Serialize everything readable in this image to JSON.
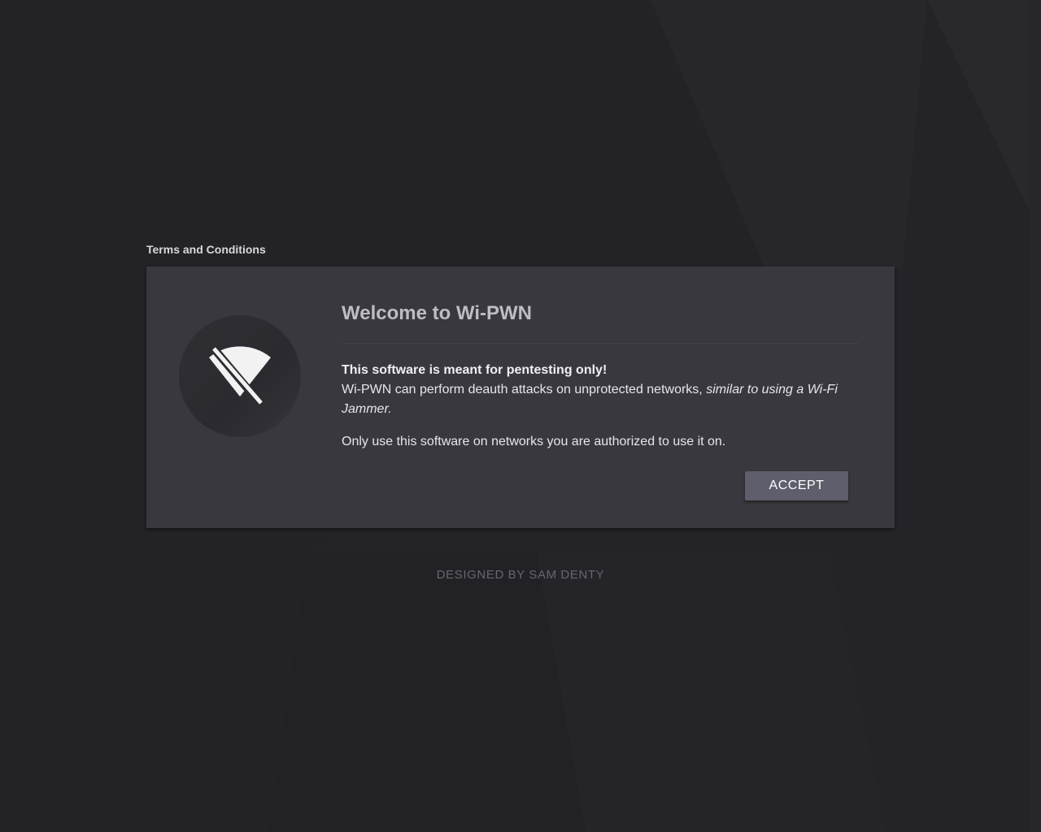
{
  "section_label": "Terms and Conditions",
  "card": {
    "icon": "wifi-off-icon",
    "title": "Welcome to Wi-PWN",
    "warning": "This software is meant for pentesting only!",
    "description_plain": "Wi-PWN can perform deauth attacks on unprotected networks, ",
    "description_italic": "similar to using a Wi-Fi Jammer.",
    "notice": "Only use this software on networks you are authorized to use it on.",
    "accept_label": "ACCEPT"
  },
  "footer": {
    "credit": "DESIGNED BY SAM DENTY"
  },
  "colors": {
    "background": "#232328",
    "card": "#38383e",
    "button": "#5e5e6c",
    "icon": "#f2f2f2"
  }
}
